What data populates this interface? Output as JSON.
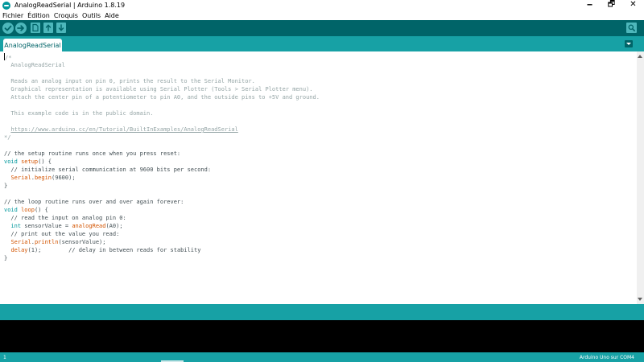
{
  "window": {
    "title": "AnalogReadSerial | Arduino 1.8.19",
    "controls": {
      "minimize": "🗕",
      "maximize": "🗗",
      "close": "✕"
    }
  },
  "menu": [
    "Fichier",
    "Édition",
    "Croquis",
    "Outils",
    "Aide"
  ],
  "toolbar": {
    "icons": [
      "verify-icon",
      "upload-icon",
      "new-icon",
      "open-icon",
      "save-icon",
      "serial-monitor-icon"
    ]
  },
  "tabs": [
    {
      "label": "AnalogReadSerial"
    }
  ],
  "editor": {
    "lines": [
      [
        {
          "t": "/*",
          "c": "cm"
        }
      ],
      [
        {
          "t": "  AnalogReadSerial",
          "c": "cm"
        }
      ],
      [],
      [
        {
          "t": "  Reads an analog input on pin 0, prints the result to the Serial Monitor.",
          "c": "cm"
        }
      ],
      [
        {
          "t": "  Graphical representation is available using Serial Plotter (Tools > Serial Plotter menu).",
          "c": "cm"
        }
      ],
      [
        {
          "t": "  Attach the center pin of a potentiometer to pin A0, and the outside pins to +5V and ground.",
          "c": "cm"
        }
      ],
      [],
      [
        {
          "t": "  This example code is in the public domain.",
          "c": "cm"
        }
      ],
      [],
      [
        {
          "t": "  ",
          "c": "cm"
        },
        {
          "t": "https://www.arduino.cc/en/Tutorial/BuiltInExamples/AnalogReadSerial",
          "c": "lnk"
        }
      ],
      [
        {
          "t": "*/",
          "c": "cm"
        }
      ],
      [],
      [
        {
          "t": "// the setup routine runs once when you press reset:",
          "c": "cl"
        }
      ],
      [
        {
          "t": "void",
          "c": "kw"
        },
        {
          "t": " ",
          "c": "tx"
        },
        {
          "t": "setup",
          "c": "fn"
        },
        {
          "t": "() {",
          "c": "tx"
        }
      ],
      [
        {
          "t": "  // initialize serial communication at 9600 bits per second:",
          "c": "cl"
        }
      ],
      [
        {
          "t": "  ",
          "c": "tx"
        },
        {
          "t": "Serial",
          "c": "fn"
        },
        {
          "t": ".",
          "c": "tx"
        },
        {
          "t": "begin",
          "c": "fn"
        },
        {
          "t": "(9600);",
          "c": "tx"
        }
      ],
      [
        {
          "t": "}",
          "c": "tx"
        }
      ],
      [],
      [
        {
          "t": "// the loop routine runs over and over again forever:",
          "c": "cl"
        }
      ],
      [
        {
          "t": "void",
          "c": "kw"
        },
        {
          "t": " ",
          "c": "tx"
        },
        {
          "t": "loop",
          "c": "fn"
        },
        {
          "t": "() {",
          "c": "tx"
        }
      ],
      [
        {
          "t": "  // read the input on analog pin 0:",
          "c": "cl"
        }
      ],
      [
        {
          "t": "  ",
          "c": "tx"
        },
        {
          "t": "int",
          "c": "kw"
        },
        {
          "t": " sensorValue = ",
          "c": "tx"
        },
        {
          "t": "analogRead",
          "c": "fn"
        },
        {
          "t": "(A0);",
          "c": "tx"
        }
      ],
      [
        {
          "t": "  // print out the value you read:",
          "c": "cl"
        }
      ],
      [
        {
          "t": "  ",
          "c": "tx"
        },
        {
          "t": "Serial",
          "c": "fn"
        },
        {
          "t": ".",
          "c": "tx"
        },
        {
          "t": "println",
          "c": "fn"
        },
        {
          "t": "(sensorValue);",
          "c": "tx"
        }
      ],
      [
        {
          "t": "  ",
          "c": "tx"
        },
        {
          "t": "delay",
          "c": "fn"
        },
        {
          "t": "(1);        ",
          "c": "tx"
        },
        {
          "t": "// delay in between reads for stability",
          "c": "cl"
        }
      ],
      [
        {
          "t": "}",
          "c": "tx"
        }
      ]
    ]
  },
  "status": {
    "line": "1",
    "board": "Arduino Uno sur COM4"
  },
  "colors": {
    "toolbar_bg": "#006468",
    "tabbar_bg": "#17a1a5",
    "button": "#4db7bb",
    "keyword": "#00979c",
    "function": "#d35400",
    "comment": "#95a5a6"
  }
}
